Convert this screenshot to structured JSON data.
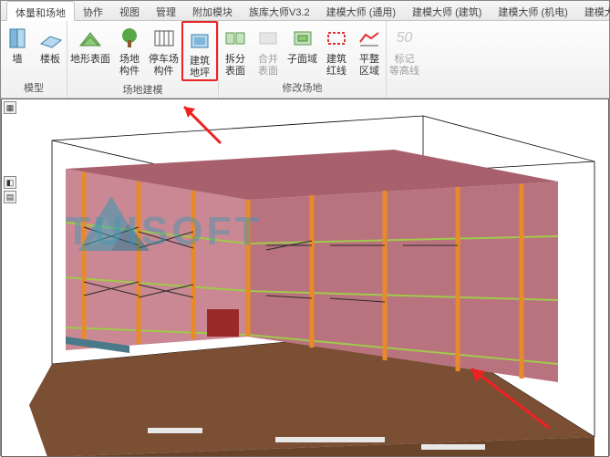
{
  "tabs": {
    "items": [
      "体量和场地",
      "协作",
      "视图",
      "管理",
      "附加模块",
      "族库大师V3.2",
      "建模大师 (通用)",
      "建模大师 (建筑)",
      "建模大师 (机电)",
      "建模大师 (施工)"
    ],
    "active_index": 0
  },
  "ribbon": {
    "groups": [
      {
        "label": "模型",
        "tools": [
          {
            "name": "wall-tool",
            "label": "墙",
            "icon": "wall"
          },
          {
            "name": "floor-tool",
            "label": "楼板",
            "icon": "floor"
          }
        ]
      },
      {
        "label": "场地建模",
        "tools": [
          {
            "name": "toposurface-tool",
            "label": "地形表面",
            "icon": "topo"
          },
          {
            "name": "site-component-tool",
            "label": "场地\n构件",
            "icon": "tree"
          },
          {
            "name": "parking-component-tool",
            "label": "停车场\n构件",
            "icon": "parking"
          },
          {
            "name": "building-pad-tool",
            "label": "建筑\n地坪",
            "icon": "pad",
            "highlight": true
          }
        ]
      },
      {
        "label": "修改场地",
        "tools": [
          {
            "name": "split-surface-tool",
            "label": "拆分\n表面",
            "icon": "split"
          },
          {
            "name": "merge-surface-tool",
            "label": "合并\n表面",
            "icon": "merge",
            "disabled": true
          },
          {
            "name": "subregion-tool",
            "label": "子面域",
            "icon": "subregion"
          },
          {
            "name": "property-line-tool",
            "label": "建筑\n红线",
            "icon": "redline"
          },
          {
            "name": "graded-region-tool",
            "label": "平整\n区域",
            "icon": "grade"
          }
        ]
      },
      {
        "label": "",
        "tools": [
          {
            "name": "label-contours-tool",
            "label": "标记\n等高线",
            "icon": "contour",
            "disabled": true,
            "value": "50"
          }
        ]
      }
    ]
  },
  "viewport": {
    "watermark_text": "TUISOFT"
  }
}
